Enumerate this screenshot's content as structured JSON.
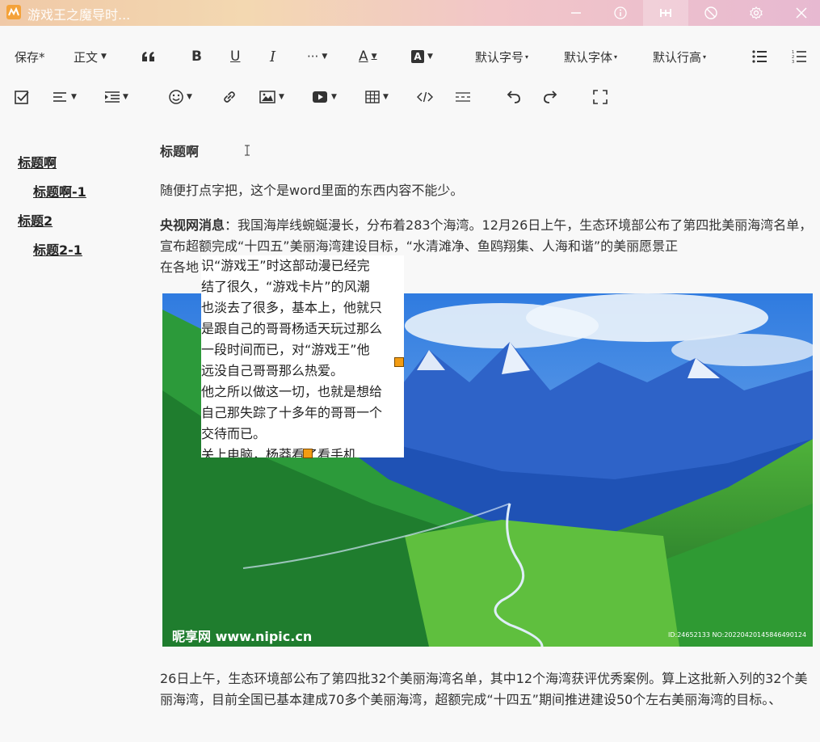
{
  "window": {
    "title": "游戏王之魔导时..."
  },
  "toolbar1": {
    "save": "保存*",
    "text_style": "正文",
    "bold": "B",
    "underline": "U",
    "italic": "I",
    "more": "···",
    "font_color": "A",
    "bg_color": "A",
    "font_size": "默认字号",
    "font_family": "默认字体",
    "line_height": "默认行高"
  },
  "outline": {
    "items": [
      "标题啊",
      "标题啊-1",
      "标题2",
      "标题2-1"
    ]
  },
  "document": {
    "heading": "标题啊",
    "para1": "随便打点字把，这个是word里面的东西内容不能少。",
    "para2_bold": "央视网消息",
    "para2_rest": "：我国海岸线蜿蜒漫长，分布着283个海湾。12月26日上午，生态环境部公布了第四批美丽海湾名单，宣布超额完成“十四五”美丽海湾建设目标，“水清滩净、鱼鸥翔集、人海和谐”的美丽愿景正",
    "para2_tail": "在各地",
    "float_lines": [
      "识“游戏王”时这部动漫已经完",
      "结了很久，“游戏卡片”的风潮",
      "也淡去了很多，基本上，他就只",
      "是跟自己的哥哥杨适天玩过那么",
      "一段时间而已，对“游戏王”他",
      "远没自己哥哥那么热爱。",
      "他之所以做这一切，也就是想给",
      "自己那失踪了十多年的哥哥一个",
      "交待而已。",
      "关上电脑，杨莽看了看手机"
    ],
    "watermark": "昵享网 www.nipic.cn",
    "image_id": "ID:24652133 NO:20220420145846490124",
    "para3": "26日上午，生态环境部公布了第四批32个美丽海湾名单，其中12个海湾获评优秀案例。算上这批新入列的32个美丽海湾，目前全国已基本建成70多个美丽海湾，超额完成“十四五”期间推进建设50个左右美丽海湾的目标。、"
  },
  "colors": {
    "accent": "#f39c12",
    "text": "#333333"
  }
}
